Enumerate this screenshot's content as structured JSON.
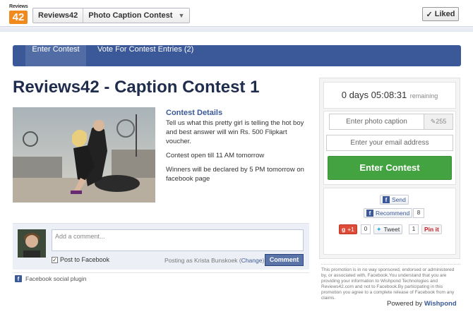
{
  "header": {
    "logo_top": "Reviews",
    "logo_num": "42",
    "crumb_page": "Reviews42",
    "crumb_app": "Photo Caption Contest",
    "liked_label": "Liked"
  },
  "nav": {
    "tabs": [
      {
        "label": "Enter Contest",
        "active": true
      },
      {
        "label": "Vote For Contest Entries (2)",
        "active": false
      }
    ]
  },
  "main": {
    "title": "Reviews42 - Caption Contest 1",
    "details_heading": "Contest Details",
    "details_text": "Tell us what this pretty girl is telling the hot boy and best answer will win Rs. 500 Flipkart voucher.",
    "open_text": "Contest open till 11 AM tomorrow",
    "winners_text": "Winners will be declared by 5 PM tomorrow on facebook page"
  },
  "comments": {
    "placeholder": "Add a comment...",
    "post_to_facebook": "Post to Facebook",
    "posting_as_prefix": "Posting as Krista Bunskoek (",
    "change_link": "Change",
    "posting_as_suffix": ")",
    "comment_button": "Comment",
    "plugin_label": "Facebook social plugin"
  },
  "panel": {
    "timer": "0 days 05:08:31",
    "remaining": "remaining",
    "caption_placeholder": "Enter photo caption",
    "caption_count": "255",
    "email_placeholder": "Enter your email address",
    "enter_button": "Enter Contest",
    "share": {
      "send": "Send",
      "recommend": "Recommend",
      "recommend_count": "8",
      "gplus": "+1",
      "gplus_count": "0",
      "tweet": "Tweet",
      "tweet_count": "1",
      "pinit": "Pin it"
    }
  },
  "footer": {
    "disclaimer": "This promotion is in no way sponsored, endorsed or administered by, or associated with, Facebook.You understand that you are providing your information to Wishpond Technologies and Reviews42.com and not to Facebook.By participating in this promotion you agree to a complete release of Facebook from any claims.",
    "powered_by": "Powered by",
    "brand": "Wishpond"
  },
  "colors": {
    "nav_blue": "#3b5998",
    "enter_green": "#44a341",
    "logo_orange": "#f08a1c"
  }
}
